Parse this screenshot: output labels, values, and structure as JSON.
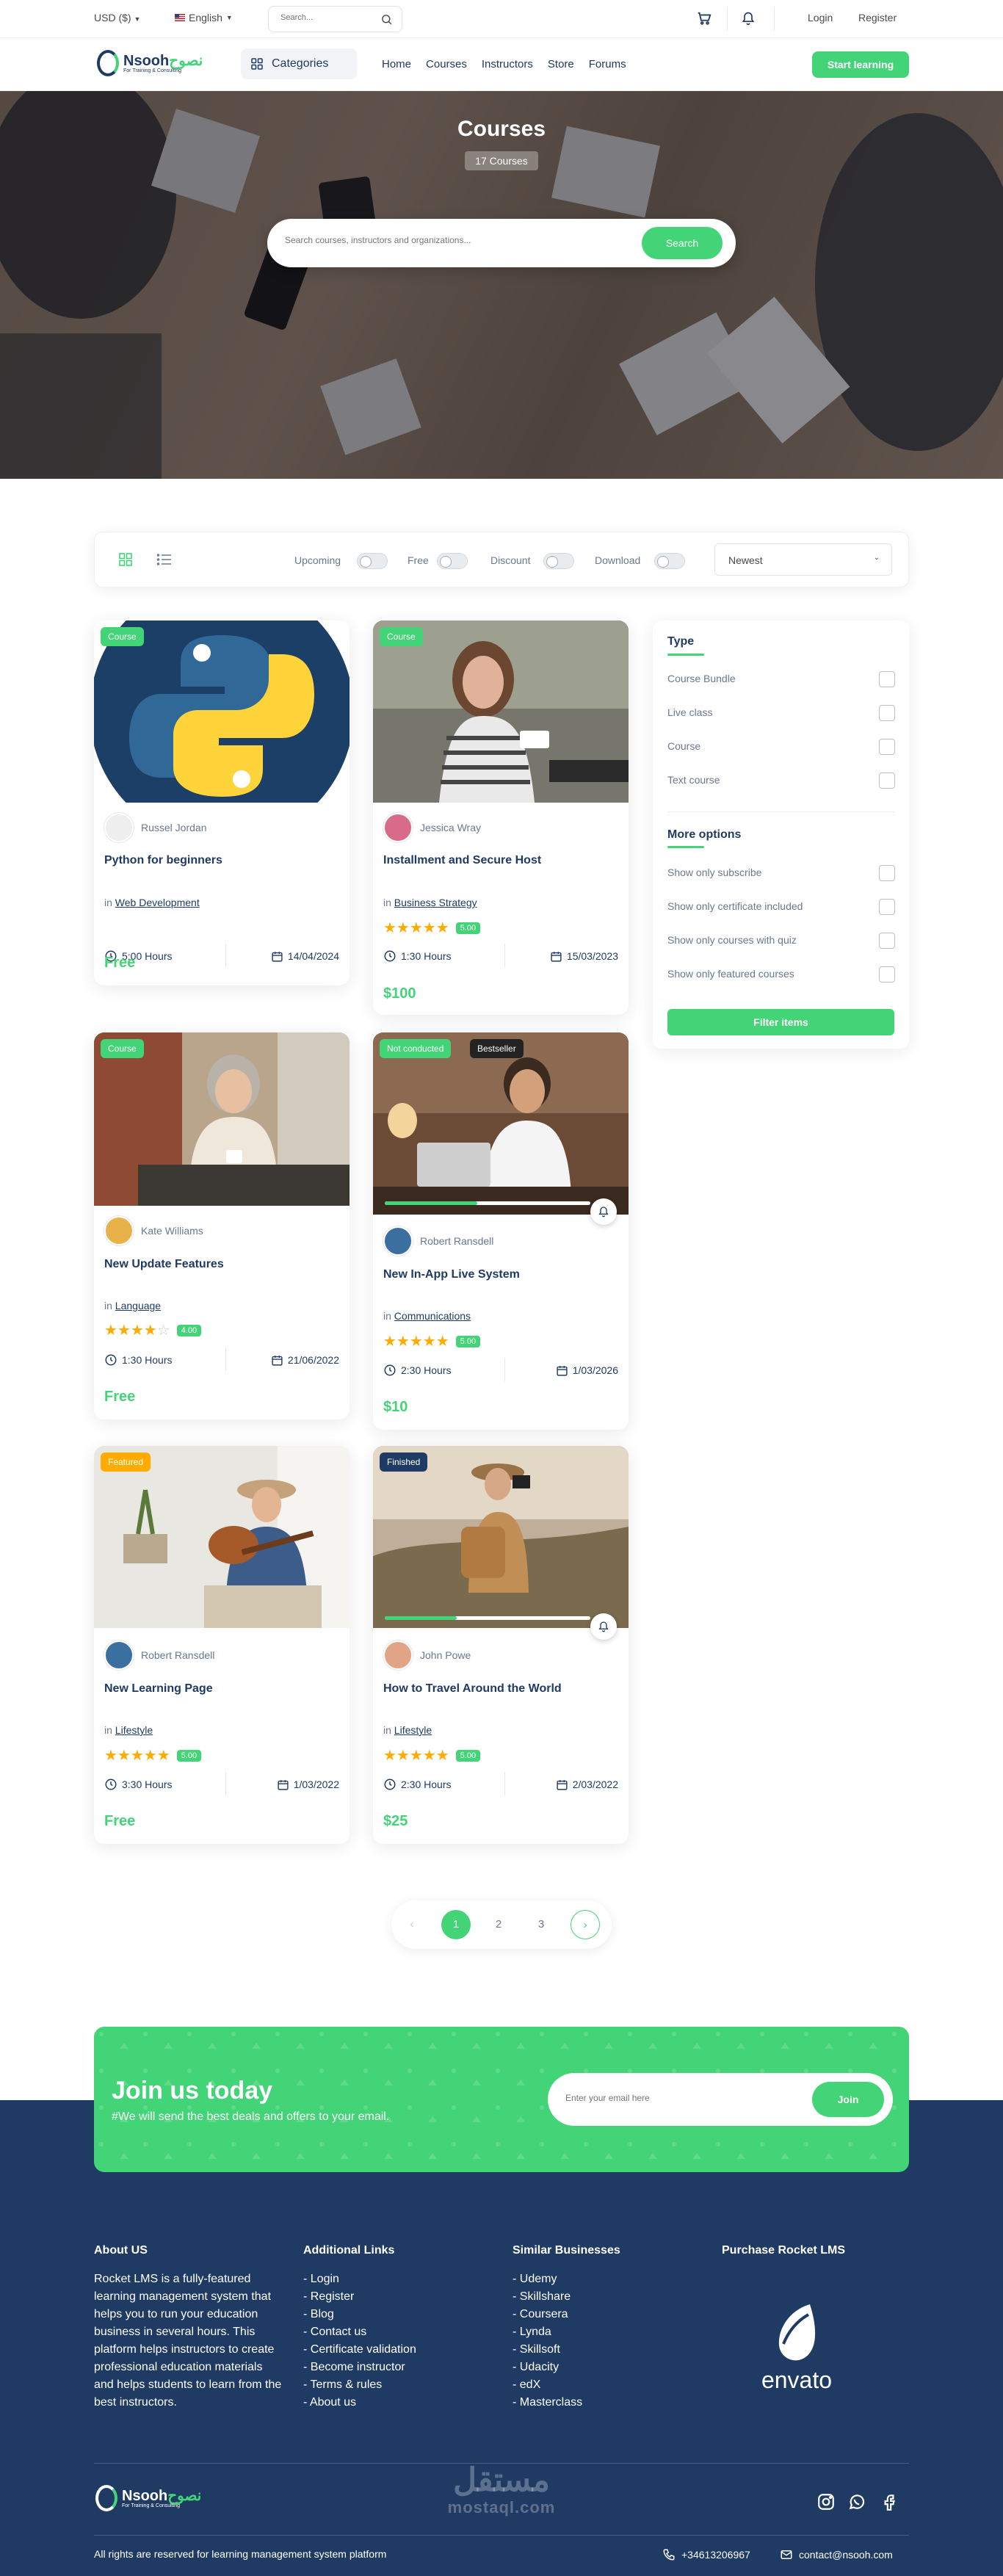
{
  "topbar": {
    "currency": "USD ($)",
    "language": "English",
    "search_placeholder": "Search...",
    "login": "Login",
    "register": "Register"
  },
  "brand": {
    "name_en": "Nsooh",
    "name_ar": "نصوح",
    "tagline": "For Training & Consulting"
  },
  "nav": {
    "categories": "Categories",
    "links": [
      "Home",
      "Courses",
      "Instructors",
      "Store",
      "Forums"
    ],
    "cta": "Start learning"
  },
  "hero": {
    "title": "Courses",
    "count": "17 Courses",
    "search_placeholder": "Search courses, instructors and organizations...",
    "search_button": "Search"
  },
  "filters": {
    "toggles": [
      "Upcoming",
      "Free",
      "Discount",
      "Download"
    ],
    "sort": "Newest"
  },
  "courses": [
    {
      "badge": "Course",
      "author": "Russel Jordan",
      "title": "Python for beginners",
      "in": "in",
      "category": "Web Development",
      "duration": "5:00 Hours",
      "date": "14/04/2024",
      "price": "Free"
    },
    {
      "badge": "Course",
      "author": "Jessica Wray",
      "title": "Installment and Secure Host",
      "in": "in",
      "category": "Business Strategy",
      "rating": "5.00",
      "duration": "1:30 Hours",
      "date": "15/03/2023",
      "price": "$100"
    },
    {
      "badge": "Course",
      "author": "Kate Williams",
      "title": "New Update Features",
      "in": "in",
      "category": "Language",
      "rating": "4.00",
      "duration": "1:30 Hours",
      "date": "21/06/2022",
      "price": "Free"
    },
    {
      "badge": "Not conducted",
      "badge2": "Bestseller",
      "author": "Robert Ransdell",
      "title": "New In-App Live System",
      "in": "in",
      "category": "Communications",
      "rating": "5.00",
      "duration": "2:30 Hours",
      "date": "1/03/2026",
      "price": "$10"
    },
    {
      "badge": "Featured",
      "author": "Robert Ransdell",
      "title": "New Learning Page",
      "in": "in",
      "category": "Lifestyle",
      "rating": "5.00",
      "duration": "3:30 Hours",
      "date": "1/03/2022",
      "price": "Free"
    },
    {
      "badge": "Finished",
      "author": "John Powe",
      "title": "How to Travel Around the World",
      "in": "in",
      "category": "Lifestyle",
      "rating": "5.00",
      "duration": "2:30 Hours",
      "date": "2/03/2022",
      "price": "$25"
    }
  ],
  "sidebar": {
    "type_title": "Type",
    "types": [
      "Course Bundle",
      "Live class",
      "Course",
      "Text course"
    ],
    "more_title": "More options",
    "more": [
      "Show only subscribe",
      "Show only certificate included",
      "Show only courses with quiz",
      "Show only featured courses"
    ],
    "button": "Filter items"
  },
  "pagination": {
    "pages": [
      "1",
      "2",
      "3"
    ],
    "prev": "‹",
    "next": "›"
  },
  "join": {
    "title": "Join us today",
    "subtitle": "#We will send the best deals and offers to your email.",
    "placeholder": "Enter your email here",
    "button": "Join"
  },
  "footer": {
    "about_title": "About US",
    "about_text": "Rocket LMS is a fully-featured learning management system that helps you to run your education business in several hours. This platform helps instructors to create professional education materials and helps students to learn from the best instructors.",
    "links_title": "Additional Links",
    "links": [
      "- Login",
      "- Register",
      "- Blog",
      "- Contact us",
      "- Certificate validation",
      "- Become instructor",
      "- Terms & rules",
      "- About us"
    ],
    "similar_title": "Similar Businesses",
    "similar": [
      "- Udemy",
      "- Skillshare",
      "- Coursera",
      "- Lynda",
      "- Skillsoft",
      "- Udacity",
      "- edX",
      "- Masterclass"
    ],
    "purchase_title": "Purchase Rocket LMS",
    "envato": "envato",
    "watermark_ar": "مستقل",
    "watermark_en": "mostaql.com",
    "copyright": "All rights are reserved for learning management system platform",
    "phone": "+34613206967",
    "email": "contact@nsooh.com"
  },
  "colors": {
    "primary": "#43d477",
    "navy": "#1f3b64",
    "star": "#ffab00",
    "featured": "#ffab00",
    "bestseller": "#232323"
  }
}
